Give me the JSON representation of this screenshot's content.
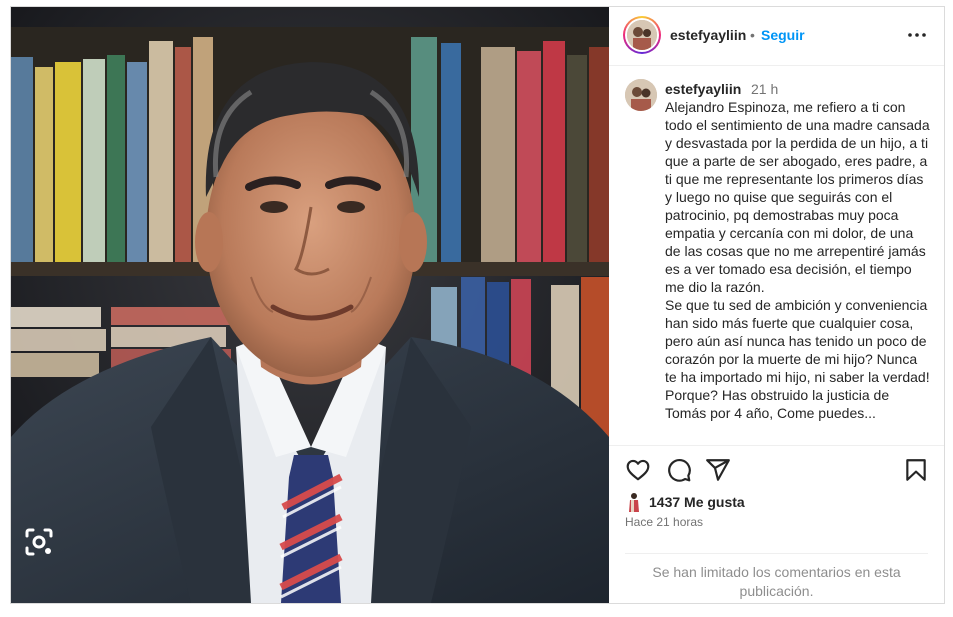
{
  "post": {
    "author": "estefyayliin",
    "separator": "•",
    "follow_label": "Seguir",
    "more_icon": "more-horizontal-icon"
  },
  "caption": {
    "author": "estefyayliin",
    "time": "21 h",
    "text": "Alejandro Espinoza, me refiero a ti con todo el sentimiento de una madre cansada y desvastada por la perdida de un hijo, a ti que a parte de ser abogado, eres padre, a ti que me representante los primeros días y luego no quise que seguirás con el patrocinio, pq demostrabas muy poca empatia y cercanía con mi dolor, de una de las cosas que no me arrepentiré jamás es a ver tomado esa decisión, el tiempo me dio la razón.\nSe que tu sed de ambición y conveniencia han sido más fuerte que cualquier cosa, pero aún así nunca has tenido un poco de corazón por la muerte de mi hijo? Nunca te ha importado mi hijo, ni saber la verdad! Porque? Has obstruido la justicia de Tomás por 4 año, Come puedes..."
  },
  "actions": {
    "like_icon": "heart-icon",
    "comment_icon": "comment-icon",
    "share_icon": "share-icon",
    "save_icon": "bookmark-icon"
  },
  "stats": {
    "likes_text": "1437 Me gusta",
    "time_ago": "Hace 21 horas"
  },
  "comments_notice": "Se han limitado los comentarios en esta publicación.",
  "colors": {
    "link_blue": "#0095f6",
    "text": "#262626",
    "muted": "#737373",
    "border": "#dbdbdb"
  }
}
